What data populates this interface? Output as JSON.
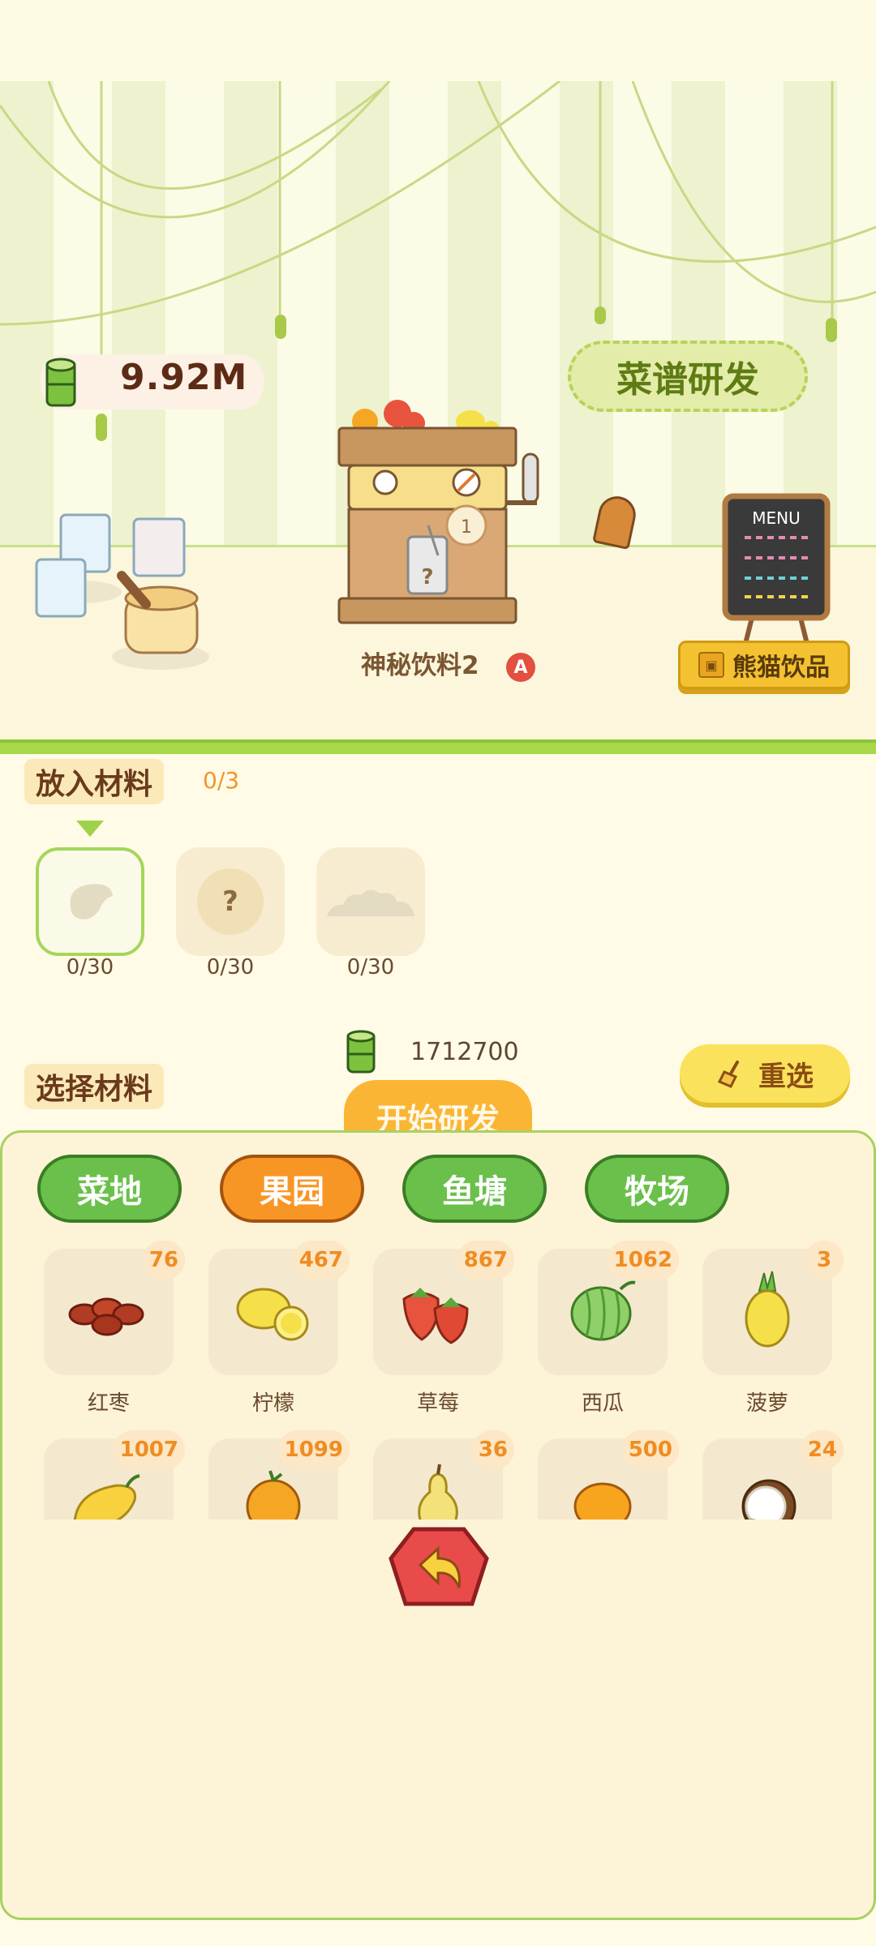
{
  "currency": {
    "value": "9.92M",
    "icon": "bamboo-icon"
  },
  "recipe_research": {
    "label": "菜谱研发"
  },
  "drink": {
    "name": "神秘饮料2",
    "badge": "A",
    "queue_number": "1",
    "cup_mark": "?"
  },
  "menu_board": {
    "title": "MENU"
  },
  "shop_sign": {
    "label": "熊猫饮品"
  },
  "put_materials": {
    "label": "放入材料",
    "progress": "0/3",
    "slots": [
      {
        "icon": "date-silhouette-icon",
        "count": "0/30",
        "active": true
      },
      {
        "icon": "question-icon",
        "mark": "?",
        "count": "0/30",
        "active": false
      },
      {
        "icon": "powder-silhouette-icon",
        "count": "0/30",
        "active": false
      }
    ]
  },
  "cost": {
    "value": "1712700",
    "icon": "bamboo-icon"
  },
  "reselect": {
    "label": "重选",
    "icon": "broom-icon"
  },
  "choose_materials": {
    "label": "选择材料"
  },
  "start_research": {
    "label": "开始研发"
  },
  "categories": [
    {
      "label": "菜地",
      "active": false
    },
    {
      "label": "果园",
      "active": true
    },
    {
      "label": "鱼塘",
      "active": false
    },
    {
      "label": "牧场",
      "active": false
    }
  ],
  "items_row1": [
    {
      "name": "红枣",
      "count": "76",
      "icon": "red-date-icon"
    },
    {
      "name": "柠檬",
      "count": "467",
      "icon": "lemon-icon"
    },
    {
      "name": "草莓",
      "count": "867",
      "icon": "strawberry-icon"
    },
    {
      "name": "西瓜",
      "count": "1062",
      "icon": "watermelon-icon"
    },
    {
      "name": "菠萝",
      "count": "3",
      "icon": "pineapple-icon"
    }
  ],
  "items_row2": [
    {
      "count": "1007",
      "icon": "mango-icon"
    },
    {
      "count": "1099",
      "icon": "orange-icon"
    },
    {
      "count": "36",
      "icon": "pear-icon"
    },
    {
      "count": "500",
      "icon": "tangerine-icon"
    },
    {
      "count": "24",
      "icon": "coconut-icon"
    }
  ],
  "back": {
    "icon": "back-arrow-icon"
  },
  "colors": {
    "accent_orange": "#f89625",
    "tab_green": "#6ac04a",
    "panel_border": "#a9d161",
    "count_orange": "#f08c21"
  }
}
